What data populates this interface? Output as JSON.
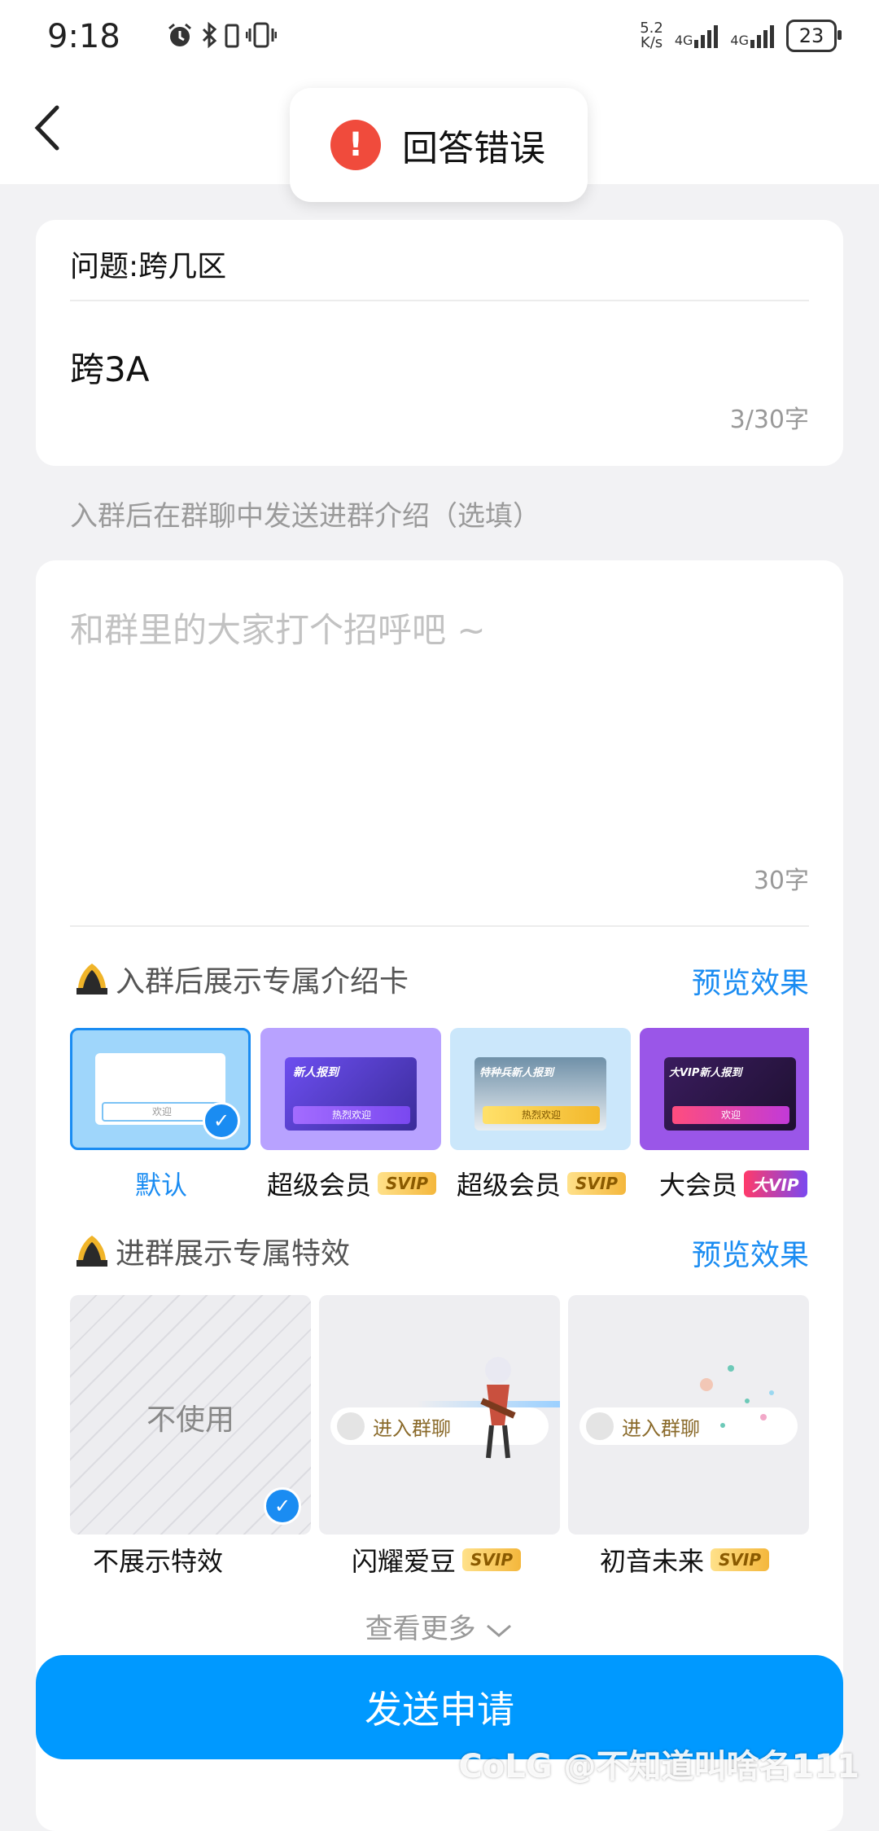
{
  "status": {
    "time": "9:18",
    "speed_value": "5.2",
    "speed_unit": "K/s",
    "net1": "4G",
    "net2": "4G",
    "battery": "23"
  },
  "toast": {
    "message": "回答错误"
  },
  "question": {
    "title": "问题:跨几区",
    "answer": "跨3A",
    "count": "3/30字"
  },
  "intro": {
    "label": "入群后在群聊中发送进群介绍（选填）",
    "placeholder": "和群里的大家打个招呼吧 ~",
    "count": "30字"
  },
  "card_section": {
    "title": "入群后展示专属介绍卡",
    "preview": "预览效果",
    "items": [
      {
        "label": "默认",
        "badge": "",
        "selected": true,
        "thumb_text": "欢迎"
      },
      {
        "label": "超级会员",
        "badge": "SVIP",
        "thumb_title": "新人报到",
        "thumb_button": "热烈欢迎"
      },
      {
        "label": "超级会员",
        "badge": "SVIP",
        "thumb_title": "特种兵新人报到",
        "thumb_button": "热烈欢迎"
      },
      {
        "label": "大会员",
        "badge": "大VIP",
        "thumb_title": "大VIP新人报到",
        "thumb_button": "欢迎"
      }
    ]
  },
  "effect_section": {
    "title": "进群展示专属特效",
    "preview": "预览效果",
    "items": [
      {
        "label": "不展示特效",
        "badge": "",
        "tile_text": "不使用",
        "selected": true
      },
      {
        "label": "闪耀爱豆",
        "badge": "SVIP",
        "pill_text": "进入群聊"
      },
      {
        "label": "初音未来",
        "badge": "SVIP",
        "pill_text": "进入群聊"
      }
    ]
  },
  "more": "查看更多",
  "send_button": "发送申请",
  "watermark": "@不知道叫啥名111",
  "watermark_logo": "CoLG",
  "colors": {
    "accent": "#1a8cf2",
    "button": "#0099ff",
    "error": "#f04b3c"
  }
}
